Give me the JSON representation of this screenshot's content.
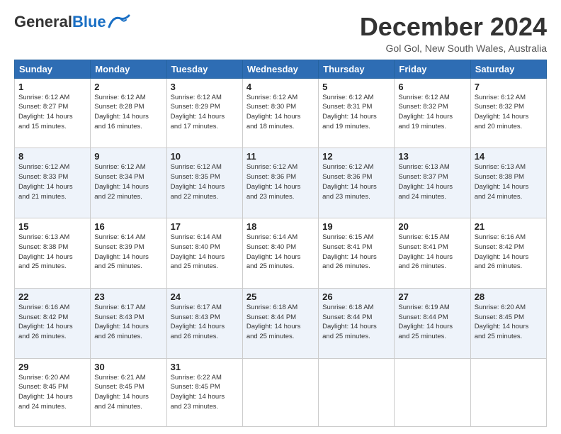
{
  "header": {
    "logo_general": "General",
    "logo_blue": "Blue",
    "month_title": "December 2024",
    "location": "Gol Gol, New South Wales, Australia"
  },
  "days_of_week": [
    "Sunday",
    "Monday",
    "Tuesday",
    "Wednesday",
    "Thursday",
    "Friday",
    "Saturday"
  ],
  "weeks": [
    [
      {
        "day": 1,
        "info": [
          "Sunrise: 6:12 AM",
          "Sunset: 8:27 PM",
          "Daylight: 14 hours",
          "and 15 minutes."
        ]
      },
      {
        "day": 2,
        "info": [
          "Sunrise: 6:12 AM",
          "Sunset: 8:28 PM",
          "Daylight: 14 hours",
          "and 16 minutes."
        ]
      },
      {
        "day": 3,
        "info": [
          "Sunrise: 6:12 AM",
          "Sunset: 8:29 PM",
          "Daylight: 14 hours",
          "and 17 minutes."
        ]
      },
      {
        "day": 4,
        "info": [
          "Sunrise: 6:12 AM",
          "Sunset: 8:30 PM",
          "Daylight: 14 hours",
          "and 18 minutes."
        ]
      },
      {
        "day": 5,
        "info": [
          "Sunrise: 6:12 AM",
          "Sunset: 8:31 PM",
          "Daylight: 14 hours",
          "and 19 minutes."
        ]
      },
      {
        "day": 6,
        "info": [
          "Sunrise: 6:12 AM",
          "Sunset: 8:32 PM",
          "Daylight: 14 hours",
          "and 19 minutes."
        ]
      },
      {
        "day": 7,
        "info": [
          "Sunrise: 6:12 AM",
          "Sunset: 8:32 PM",
          "Daylight: 14 hours",
          "and 20 minutes."
        ]
      }
    ],
    [
      {
        "day": 8,
        "info": [
          "Sunrise: 6:12 AM",
          "Sunset: 8:33 PM",
          "Daylight: 14 hours",
          "and 21 minutes."
        ]
      },
      {
        "day": 9,
        "info": [
          "Sunrise: 6:12 AM",
          "Sunset: 8:34 PM",
          "Daylight: 14 hours",
          "and 22 minutes."
        ]
      },
      {
        "day": 10,
        "info": [
          "Sunrise: 6:12 AM",
          "Sunset: 8:35 PM",
          "Daylight: 14 hours",
          "and 22 minutes."
        ]
      },
      {
        "day": 11,
        "info": [
          "Sunrise: 6:12 AM",
          "Sunset: 8:36 PM",
          "Daylight: 14 hours",
          "and 23 minutes."
        ]
      },
      {
        "day": 12,
        "info": [
          "Sunrise: 6:12 AM",
          "Sunset: 8:36 PM",
          "Daylight: 14 hours",
          "and 23 minutes."
        ]
      },
      {
        "day": 13,
        "info": [
          "Sunrise: 6:13 AM",
          "Sunset: 8:37 PM",
          "Daylight: 14 hours",
          "and 24 minutes."
        ]
      },
      {
        "day": 14,
        "info": [
          "Sunrise: 6:13 AM",
          "Sunset: 8:38 PM",
          "Daylight: 14 hours",
          "and 24 minutes."
        ]
      }
    ],
    [
      {
        "day": 15,
        "info": [
          "Sunrise: 6:13 AM",
          "Sunset: 8:38 PM",
          "Daylight: 14 hours",
          "and 25 minutes."
        ]
      },
      {
        "day": 16,
        "info": [
          "Sunrise: 6:14 AM",
          "Sunset: 8:39 PM",
          "Daylight: 14 hours",
          "and 25 minutes."
        ]
      },
      {
        "day": 17,
        "info": [
          "Sunrise: 6:14 AM",
          "Sunset: 8:40 PM",
          "Daylight: 14 hours",
          "and 25 minutes."
        ]
      },
      {
        "day": 18,
        "info": [
          "Sunrise: 6:14 AM",
          "Sunset: 8:40 PM",
          "Daylight: 14 hours",
          "and 25 minutes."
        ]
      },
      {
        "day": 19,
        "info": [
          "Sunrise: 6:15 AM",
          "Sunset: 8:41 PM",
          "Daylight: 14 hours",
          "and 26 minutes."
        ]
      },
      {
        "day": 20,
        "info": [
          "Sunrise: 6:15 AM",
          "Sunset: 8:41 PM",
          "Daylight: 14 hours",
          "and 26 minutes."
        ]
      },
      {
        "day": 21,
        "info": [
          "Sunrise: 6:16 AM",
          "Sunset: 8:42 PM",
          "Daylight: 14 hours",
          "and 26 minutes."
        ]
      }
    ],
    [
      {
        "day": 22,
        "info": [
          "Sunrise: 6:16 AM",
          "Sunset: 8:42 PM",
          "Daylight: 14 hours",
          "and 26 minutes."
        ]
      },
      {
        "day": 23,
        "info": [
          "Sunrise: 6:17 AM",
          "Sunset: 8:43 PM",
          "Daylight: 14 hours",
          "and 26 minutes."
        ]
      },
      {
        "day": 24,
        "info": [
          "Sunrise: 6:17 AM",
          "Sunset: 8:43 PM",
          "Daylight: 14 hours",
          "and 26 minutes."
        ]
      },
      {
        "day": 25,
        "info": [
          "Sunrise: 6:18 AM",
          "Sunset: 8:44 PM",
          "Daylight: 14 hours",
          "and 25 minutes."
        ]
      },
      {
        "day": 26,
        "info": [
          "Sunrise: 6:18 AM",
          "Sunset: 8:44 PM",
          "Daylight: 14 hours",
          "and 25 minutes."
        ]
      },
      {
        "day": 27,
        "info": [
          "Sunrise: 6:19 AM",
          "Sunset: 8:44 PM",
          "Daylight: 14 hours",
          "and 25 minutes."
        ]
      },
      {
        "day": 28,
        "info": [
          "Sunrise: 6:20 AM",
          "Sunset: 8:45 PM",
          "Daylight: 14 hours",
          "and 25 minutes."
        ]
      }
    ],
    [
      {
        "day": 29,
        "info": [
          "Sunrise: 6:20 AM",
          "Sunset: 8:45 PM",
          "Daylight: 14 hours",
          "and 24 minutes."
        ]
      },
      {
        "day": 30,
        "info": [
          "Sunrise: 6:21 AM",
          "Sunset: 8:45 PM",
          "Daylight: 14 hours",
          "and 24 minutes."
        ]
      },
      {
        "day": 31,
        "info": [
          "Sunrise: 6:22 AM",
          "Sunset: 8:45 PM",
          "Daylight: 14 hours",
          "and 23 minutes."
        ]
      },
      null,
      null,
      null,
      null
    ]
  ]
}
